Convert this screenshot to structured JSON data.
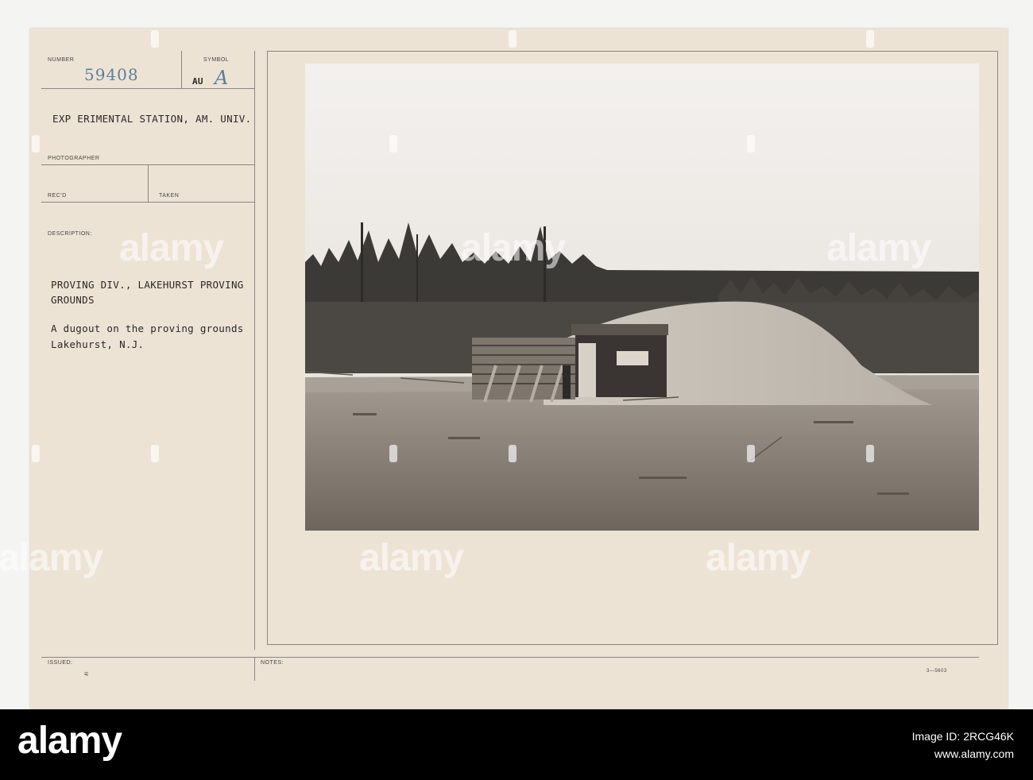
{
  "card": {
    "labels": {
      "number": "NUMBER",
      "symbol": "SYMBOL",
      "photographer": "PHOTOGRAPHER",
      "recd": "REC'D",
      "taken": "TAKEN",
      "description": "DESCRIPTION:",
      "issued": "ISSUED:",
      "notes": "NOTES:"
    },
    "number_value": "59408",
    "symbol_prefix": "AU",
    "symbol_value": "A",
    "station": "EXP ERIMENTAL STATION, AM. UNIV.",
    "description_line1": "PROVING DIV., LAKEHURST PROVING",
    "description_line2": "GROUNDS",
    "caption_line1": "A dugout on the proving grounds",
    "caption_line2": "Lakehurst, N.J.",
    "form_code": "3—5603"
  },
  "watermark": {
    "text": "alamy"
  },
  "footer": {
    "brand": "alamy",
    "image_id_label": "Image ID: 2RCG46K",
    "site": "www.alamy.com"
  }
}
